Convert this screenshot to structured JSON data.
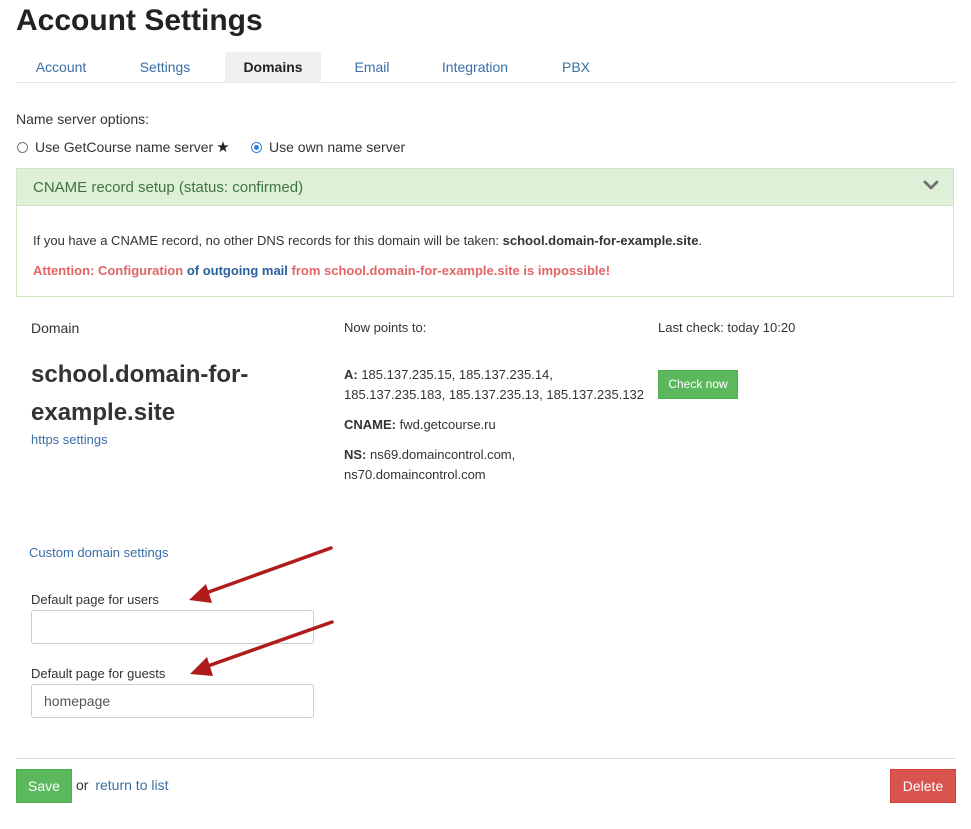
{
  "page": {
    "title": "Account Settings"
  },
  "tabs": [
    {
      "label": "Account"
    },
    {
      "label": "Settings"
    },
    {
      "label": "Domains",
      "active": true
    },
    {
      "label": "Email"
    },
    {
      "label": "Integration"
    },
    {
      "label": "PBX"
    }
  ],
  "name_server": {
    "label": "Name server options:",
    "option_getcourse": "Use GetCourse name server",
    "option_own": "Use own name server",
    "selected": "own"
  },
  "cname": {
    "title": "CNAME record setup (status: confirmed)",
    "info_prefix": "If you have a CNAME record, no other DNS records for this domain will be taken: ",
    "info_domain": "school.domain-for-example.site",
    "info_suffix": ".",
    "warn_part1": "Attention: Configuration ",
    "warn_part2": "of outgoing mail",
    "warn_part3": " from school.domain-for-example.site is impossible!"
  },
  "domain": {
    "header": "Domain",
    "name_line1": "school.domain-for-",
    "name_line2": "example.site",
    "https_link": "https settings"
  },
  "points": {
    "header": "Now points to:",
    "a_label": "A:",
    "a_value_line1": " 185.137.235.15, 185.137.235.14,",
    "a_value_line2": "185.137.235.183, 185.137.235.13, 185.137.235.132",
    "cname_label": "CNAME:",
    "cname_value": " fwd.getcourse.ru",
    "ns_label": "NS:",
    "ns_value_line1": " ns69.domaincontrol.com,",
    "ns_value_line2": "ns70.domaincontrol.com"
  },
  "last_check": {
    "text": "Last check: today 10:20",
    "button": "Check now"
  },
  "custom": {
    "link": "Custom domain settings",
    "users_label": "Default page for users",
    "users_value": "",
    "guests_label": "Default page for guests",
    "guests_value": "homepage"
  },
  "footer": {
    "save": "Save",
    "or_text": "or",
    "return_link": "return to list",
    "delete": "Delete"
  },
  "colors": {
    "accent_link": "#3a6ea5",
    "success": "#5cb85c",
    "danger": "#d9534f",
    "panel_bg": "#dff0d8",
    "annotation_arrow": "#b01c1c"
  }
}
